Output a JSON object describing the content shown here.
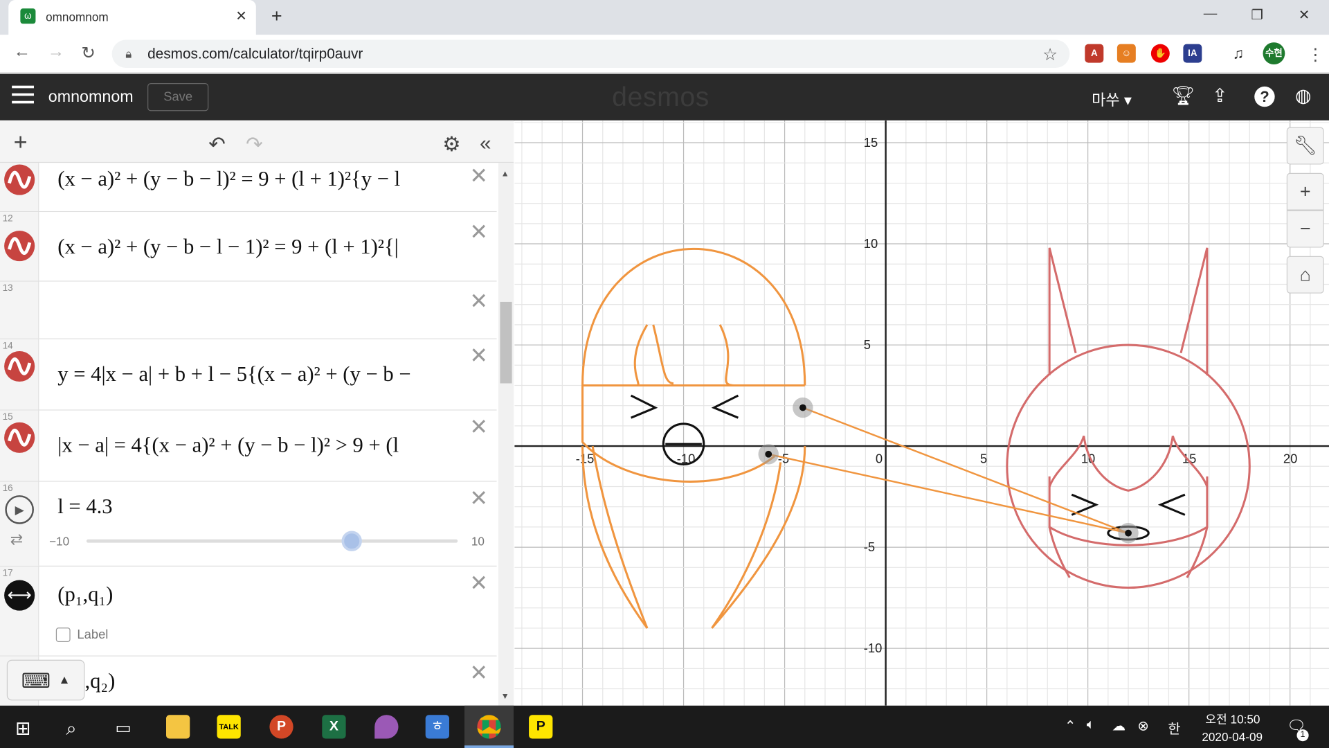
{
  "browser": {
    "tab_title": "omnomnom",
    "url": "desmos.com/calculator/tqirp0auvr",
    "avatar_label": "수현"
  },
  "desmos": {
    "graph_title": "omnomnom",
    "save_label": "Save",
    "logo": "desmos",
    "language": "마쑤"
  },
  "expressions": [
    {
      "num": "",
      "latex": "(x − a)² + (y − b − l)² = 9 + (l + 1)²{y − l"
    },
    {
      "num": "12",
      "latex": "(x − a)² + (y − b − l − 1)² = 9 + (l + 1)²{|"
    },
    {
      "num": "13",
      "latex": ""
    },
    {
      "num": "14",
      "latex": "y = 4|x − a| + b + l − 5{(x − a)² + (y − b −"
    },
    {
      "num": "15",
      "latex": "|x − a| = 4{(x − a)² + (y − b − l)² > 9 + (l"
    },
    {
      "num": "16",
      "latex": "l = 4.3",
      "slider_min": "−10",
      "slider_max": "10",
      "slider_value": 4.3
    },
    {
      "num": "17",
      "latex": "(p₁,q₁)",
      "label_text": "Label"
    },
    {
      "num": "",
      "latex": ",q₂)"
    }
  ],
  "axes": {
    "x_ticks": [
      "-15",
      "-10",
      "-5",
      "0",
      "5",
      "10",
      "15",
      "20"
    ],
    "y_ticks": [
      "15",
      "10",
      "5",
      "-5",
      "-10"
    ]
  },
  "taskbar": {
    "time": "오전 10:50",
    "date": "2020-04-09",
    "ime": "한",
    "notif_count": "1"
  },
  "colors": {
    "orange": "#f0953f",
    "red": "#d46b6b",
    "desmos_red": "#c74440",
    "header": "#2a2a2a"
  }
}
